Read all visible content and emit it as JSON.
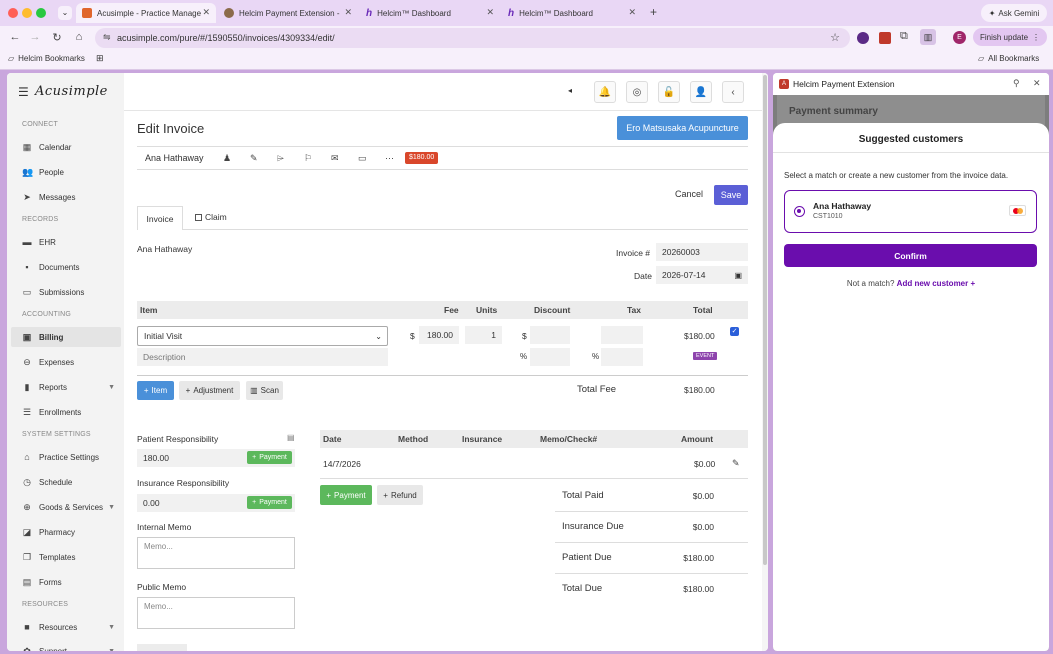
{
  "browser": {
    "tabs": [
      {
        "title": "Acusimple - Practice Manage",
        "active": true
      },
      {
        "title": "Helcim Payment Extension -",
        "active": false
      },
      {
        "title": "Helcim™ Dashboard",
        "active": false
      },
      {
        "title": "Helcim™ Dashboard",
        "active": false
      }
    ],
    "ask_gemini": "Ask Gemini",
    "url": "acusimple.com/pure/#/1590550/invoices/4309334/edit/",
    "finish_update": "Finish update",
    "profile_initial": "E",
    "bookmarks_folder": "Helcim Bookmarks",
    "all_bookmarks": "All Bookmarks"
  },
  "app": {
    "logo": "Acusimple",
    "sidebar": [
      {
        "type": "section",
        "label": "CONNECT"
      },
      {
        "type": "item",
        "label": "Calendar",
        "icon": "calendar-icon",
        "glyph": "▦"
      },
      {
        "type": "item",
        "label": "People",
        "icon": "people-icon",
        "glyph": "👥"
      },
      {
        "type": "item",
        "label": "Messages",
        "icon": "send-icon",
        "glyph": "➤"
      },
      {
        "type": "section",
        "label": "RECORDS"
      },
      {
        "type": "item",
        "label": "EHR",
        "icon": "folder-icon",
        "glyph": "▬"
      },
      {
        "type": "item",
        "label": "Documents",
        "icon": "briefcase-icon",
        "glyph": "▪"
      },
      {
        "type": "item",
        "label": "Submissions",
        "icon": "laptop-icon",
        "glyph": "▭"
      },
      {
        "type": "section",
        "label": "ACCOUNTING"
      },
      {
        "type": "item",
        "label": "Billing",
        "icon": "billing-icon",
        "glyph": "▣",
        "active": true
      },
      {
        "type": "item",
        "label": "Expenses",
        "icon": "minus-circle-icon",
        "glyph": "⊖"
      },
      {
        "type": "item",
        "label": "Reports",
        "icon": "bar-chart-icon",
        "glyph": "▮",
        "caret": true
      },
      {
        "type": "item",
        "label": "Enrollments",
        "icon": "list-icon",
        "glyph": "☰"
      },
      {
        "type": "section",
        "label": "SYSTEM SETTINGS"
      },
      {
        "type": "item",
        "label": "Practice Settings",
        "icon": "home-icon",
        "glyph": "⌂"
      },
      {
        "type": "item",
        "label": "Schedule",
        "icon": "clock-icon",
        "glyph": "◷"
      },
      {
        "type": "item",
        "label": "Goods & Services",
        "icon": "cart-icon",
        "glyph": "⊕",
        "caret": true
      },
      {
        "type": "item",
        "label": "Pharmacy",
        "icon": "pill-icon",
        "glyph": "◪"
      },
      {
        "type": "item",
        "label": "Templates",
        "icon": "copy-icon",
        "glyph": "❐"
      },
      {
        "type": "item",
        "label": "Forms",
        "icon": "file-icon",
        "glyph": "▤"
      },
      {
        "type": "section",
        "label": "RESOURCES"
      },
      {
        "type": "item",
        "label": "Resources",
        "icon": "book-icon",
        "glyph": "■",
        "caret": true
      },
      {
        "type": "item",
        "label": "Support",
        "icon": "support-icon",
        "glyph": "✿",
        "caret": true
      }
    ],
    "page_title": "Edit Invoice",
    "practitioner_button": "Ero Matsusaka Acupuncture",
    "patient_name": "Ana Hathaway",
    "balance_badge": "$180.00",
    "cancel": "Cancel",
    "save": "Save",
    "tabs": {
      "invoice": "Invoice",
      "claim": "Claim"
    },
    "bill_to": "Ana Hathaway",
    "invoice_no_label": "Invoice #",
    "invoice_no": "20260003",
    "date_label": "Date",
    "date": "2026-07-14",
    "items_header": {
      "item": "Item",
      "fee": "Fee",
      "units": "Units",
      "discount": "Discount",
      "tax": "Tax",
      "total": "Total"
    },
    "line_item": {
      "name": "Initial Visit",
      "currency": "$",
      "fee": "180.00",
      "units": "1",
      "discount_prefix": "$",
      "total": "$180.00",
      "description_placeholder": "Description",
      "percent1": "%",
      "percent2": "%",
      "event_badge": "EVENT"
    },
    "add_item": "Item",
    "add_adjustment": "Adjustment",
    "scan": "Scan",
    "total_fee_label": "Total Fee",
    "total_fee": "$180.00",
    "patient_resp_label": "Patient Responsibility",
    "patient_resp": "180.00",
    "insurance_resp_label": "Insurance Responsibility",
    "insurance_resp": "0.00",
    "payment_btn": "Payment",
    "internal_memo_label": "Internal Memo",
    "public_memo_label": "Public Memo",
    "memo_placeholder": "Memo...",
    "payments_header": {
      "date": "Date",
      "method": "Method",
      "insurance": "Insurance",
      "memo": "Memo/Check#",
      "amount": "Amount"
    },
    "payment_row": {
      "date": "14/7/2026",
      "amount": "$0.00"
    },
    "refund_btn": "Refund",
    "summary": [
      {
        "label": "Total Paid",
        "value": "$0.00"
      },
      {
        "label": "Insurance Due",
        "value": "$0.00"
      },
      {
        "label": "Patient Due",
        "value": "$180.00"
      },
      {
        "label": "Total Due",
        "value": "$180.00"
      }
    ]
  },
  "extension": {
    "title": "Helcim Payment Extension",
    "bg_title": "Payment summary",
    "modal_title": "Suggested customers",
    "instructions": "Select a match or create a new customer from the invoice data.",
    "customer_name": "Ana Hathaway",
    "customer_id": "CST1010",
    "confirm": "Confirm",
    "not_match": "Not a match?",
    "add_new": "Add new customer +",
    "accent": "#6a0dad"
  }
}
